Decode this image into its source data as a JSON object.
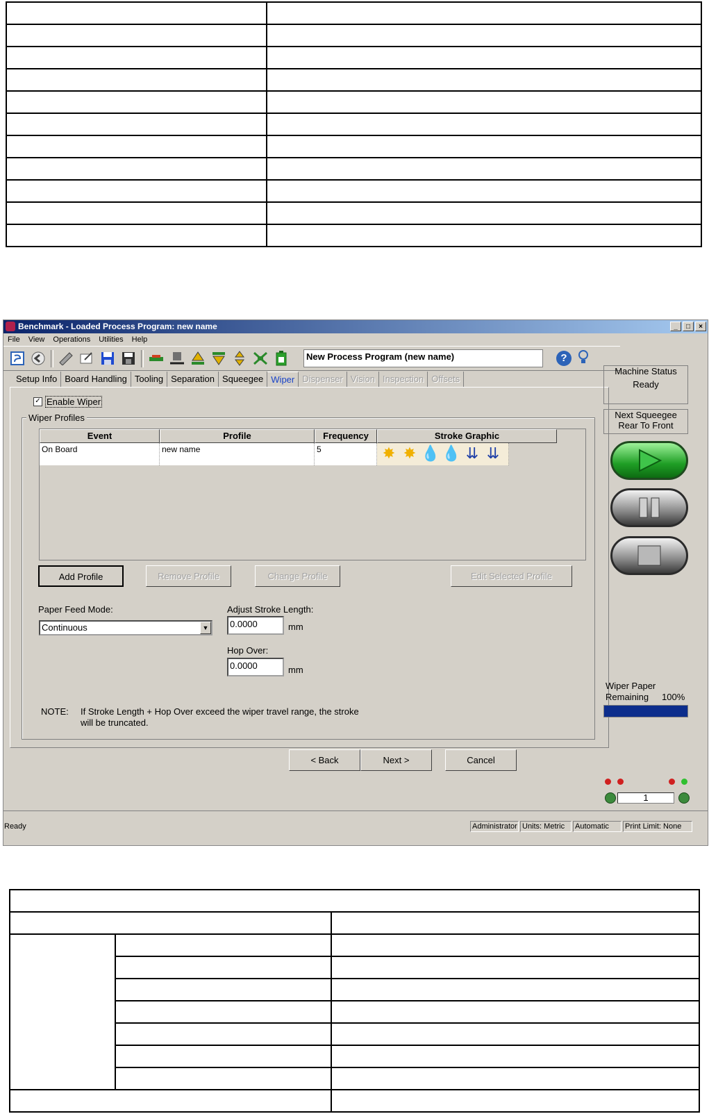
{
  "window": {
    "title": "Benchmark - Loaded Process Program:  new name",
    "controls": [
      "_",
      "□",
      "×"
    ]
  },
  "menu": [
    "File",
    "View",
    "Operations",
    "Utilities",
    "Help"
  ],
  "toolbar": {
    "program_field": "New Process Program (new name)",
    "help": "?",
    "icons": [
      "logo-icon",
      "back-icon",
      "open-icon",
      "edit-icon",
      "save-icon",
      "save-all-icon",
      "board-icon",
      "squeegee-icon",
      "up-icon",
      "down-icon",
      "updown-icon",
      "network-icon",
      "battery-icon",
      "help-icon",
      "lightbulb-icon"
    ]
  },
  "tabs": [
    {
      "label": "Setup Info",
      "state": "normal"
    },
    {
      "label": "Board Handling",
      "state": "normal"
    },
    {
      "label": "Tooling",
      "state": "normal"
    },
    {
      "label": "Separation",
      "state": "normal"
    },
    {
      "label": "Squeegee",
      "state": "normal"
    },
    {
      "label": "Wiper",
      "state": "active"
    },
    {
      "label": "Dispenser",
      "state": "disabled"
    },
    {
      "label": "Vision",
      "state": "disabled"
    },
    {
      "label": "Inspection",
      "state": "disabled"
    },
    {
      "label": "Offsets",
      "state": "disabled"
    }
  ],
  "wiper": {
    "enable_label": "Enable Wiper",
    "enable_checked": "✓",
    "profiles_title": "Wiper Profiles",
    "columns": [
      "Event",
      "Profile",
      "Frequency",
      "Stroke Graphic"
    ],
    "rows": [
      {
        "event": "On Board",
        "profile": "new name",
        "frequency": "5"
      }
    ],
    "stroke_glyphs": [
      "✸",
      "✸",
      "💧",
      "💧",
      "⇊",
      "⇊"
    ],
    "buttons": {
      "add": "Add Profile",
      "remove": "Remove Profile",
      "change": "Change Profile",
      "edit": "Edit Selected Profile"
    },
    "paper_feed_label": "Paper Feed Mode:",
    "paper_feed_value": "Continuous",
    "stroke_length_label": "Adjust Stroke Length:",
    "stroke_length_value": "0.0000",
    "hop_over_label": "Hop Over:",
    "hop_over_value": "0.0000",
    "unit": "mm",
    "note_label": "NOTE:",
    "note_line1": "If Stroke Length + Hop Over exceed the wiper travel range, the stroke",
    "note_line2": "will be truncated."
  },
  "nav": {
    "back": "< Back",
    "next": "Next >",
    "cancel": "Cancel"
  },
  "side": {
    "machine_status_label": "Machine Status",
    "machine_status_value": "Ready",
    "next_squeegee_label": "Next Squeegee",
    "next_squeegee_value": "Rear To Front",
    "paper_label": "Wiper Paper",
    "paper_remaining_label": "Remaining",
    "paper_remaining_value": "100%",
    "paper_remaining_fraction": 1.0,
    "counter": "1"
  },
  "status": {
    "ready": "Ready",
    "user": "Administrator",
    "units": "Units: Metric",
    "mode": "Automatic",
    "print_limit": "Print Limit: None"
  },
  "colors": {
    "title_start": "#0a246a",
    "title_end": "#a6caf0",
    "active_tab": "#1a44c8",
    "progress": "#0c2d8c"
  }
}
